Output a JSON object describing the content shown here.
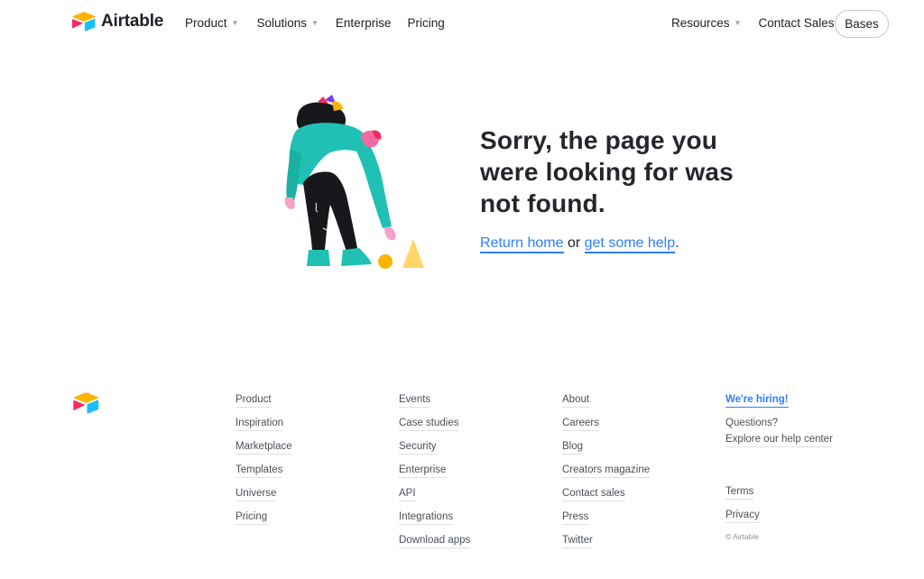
{
  "header": {
    "brand": "Airtable",
    "nav_left": [
      {
        "label": "Product",
        "has_dropdown": true
      },
      {
        "label": "Solutions",
        "has_dropdown": true
      },
      {
        "label": "Enterprise",
        "has_dropdown": false
      },
      {
        "label": "Pricing",
        "has_dropdown": false
      }
    ],
    "nav_right": [
      {
        "label": "Resources",
        "has_dropdown": true
      },
      {
        "label": "Contact Sales",
        "has_dropdown": false
      }
    ],
    "bases_button": "Bases"
  },
  "error": {
    "headline_line1": "Sorry, the page you",
    "headline_line2": "were looking for was",
    "headline_line3": "not found.",
    "return_home": "Return home",
    "or_text": " or ",
    "help_link": "get some help",
    "period": "."
  },
  "footer": {
    "col1": [
      "Product",
      "Inspiration",
      "Marketplace",
      "Templates",
      "Universe",
      "Pricing"
    ],
    "col2": [
      "Events",
      "Case studies",
      "Security",
      "Enterprise",
      "API",
      "Integrations",
      "Download apps"
    ],
    "col3": [
      "About",
      "Careers",
      "Blog",
      "Creators magazine",
      "Contact sales",
      "Press",
      "Twitter"
    ],
    "col4": {
      "hiring": "We're hiring!",
      "questions": "Questions?",
      "help_center": "Explore our help center",
      "terms": "Terms",
      "privacy": "Privacy",
      "copyright": "© Airtable"
    }
  },
  "colors": {
    "link_blue": "#2d7ff9",
    "text_dark": "#1d1f25",
    "logo_yellow": "#fcb400",
    "logo_blue": "#18bfff",
    "logo_red": "#f82b60"
  }
}
